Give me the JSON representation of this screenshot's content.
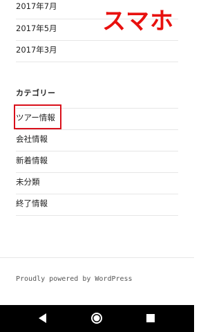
{
  "archives": [
    {
      "label": "2017年7月"
    },
    {
      "label": "2017年5月"
    },
    {
      "label": "2017年3月"
    }
  ],
  "categories": {
    "title": "カテゴリー",
    "items": [
      {
        "label": "ツアー情報"
      },
      {
        "label": "会社情報"
      },
      {
        "label": "新着情報"
      },
      {
        "label": "未分類"
      },
      {
        "label": "終了情報"
      }
    ]
  },
  "annotation": {
    "label": "スマホ",
    "color": "#e8100e"
  },
  "footer": {
    "credit": "Proudly powered by WordPress"
  },
  "navbar": {
    "back_icon": "back-triangle-icon",
    "home_icon": "home-circle-icon",
    "recent_icon": "recent-apps-square-icon"
  }
}
